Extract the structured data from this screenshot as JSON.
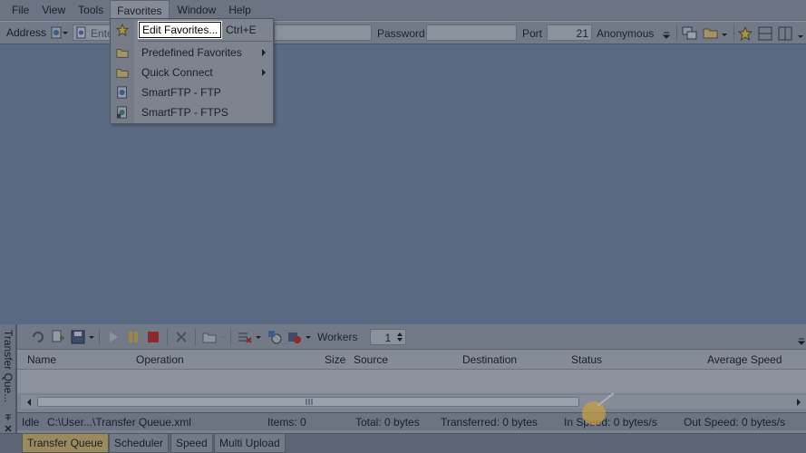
{
  "menu": {
    "file": "File",
    "view": "View",
    "tools": "Tools",
    "favorites": "Favorites",
    "window": "Window",
    "help": "Help"
  },
  "address_bar": {
    "address_label": "Address",
    "address_placeholder": "Ente",
    "password_label": "Password",
    "port_label": "Port",
    "port_value": "21",
    "anonymous_label": "Anonymous"
  },
  "favorites_menu": {
    "edit": "Edit Favorites...",
    "edit_shortcut": "Ctrl+E",
    "predefined": "Predefined Favorites",
    "quick_connect": "Quick Connect",
    "smartftp_ftp": "SmartFTP - FTP",
    "smartftp_ftps": "SmartFTP - FTPS"
  },
  "queue_toolbar": {
    "workers_label": "Workers",
    "workers_value": "1"
  },
  "queue_columns": [
    "Name",
    "Operation",
    "Size",
    "Source",
    "Destination",
    "Status",
    "Average Speed"
  ],
  "sidetab_label": "Transfer Que...",
  "status": {
    "idle": "Idle",
    "path": "C:\\User...\\Transfer Queue.xml",
    "items": "Items: 0",
    "total": "Total: 0 bytes",
    "transferred": "Transferred: 0 bytes",
    "in_speed": "In Speed: 0 bytes/s",
    "out_speed": "Out Speed: 0 bytes/s"
  },
  "bottom_tabs": [
    "Transfer Queue",
    "Scheduler",
    "Speed",
    "Multi Upload"
  ],
  "colors": {
    "active_tab": "#9a8a5e",
    "menu_bg": "#6c7484",
    "main_bg": "#5a6a82"
  }
}
